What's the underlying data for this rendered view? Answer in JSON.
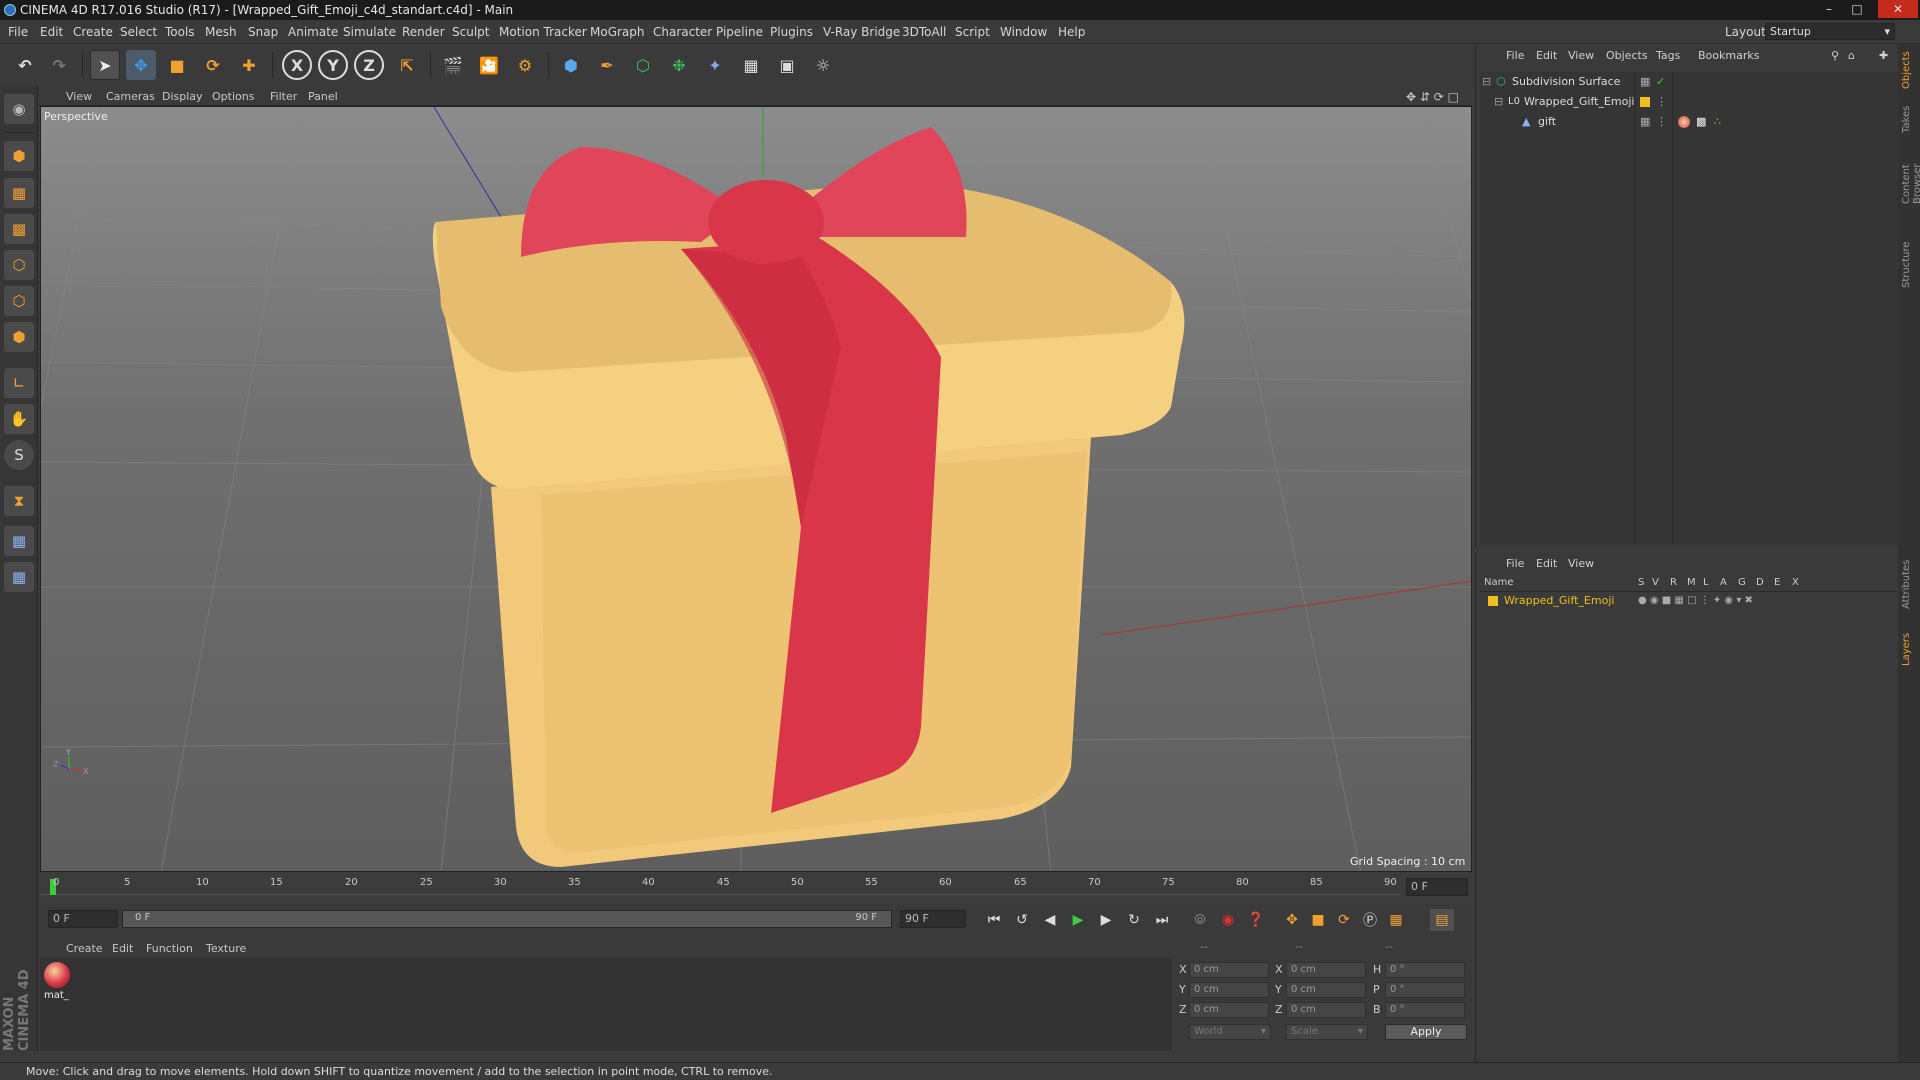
{
  "window": {
    "title": "CINEMA 4D R17.016 Studio (R17) - [Wrapped_Gift_Emoji_c4d_standart.c4d] - Main",
    "controls": [
      "minimize",
      "maximize",
      "close"
    ]
  },
  "menubar": {
    "items": [
      "File",
      "Edit",
      "Create",
      "Select",
      "Tools",
      "Mesh",
      "Snap",
      "Animate",
      "Simulate",
      "Render",
      "Sculpt",
      "Motion Tracker",
      "MoGraph",
      "Character",
      "Pipeline",
      "Plugins",
      "V-Ray Bridge",
      "3DToAll",
      "Script",
      "Window",
      "Help"
    ],
    "layout_label": "Layout:",
    "layout_value": "Startup"
  },
  "toolbar": {
    "axis_x": "X",
    "axis_y": "Y",
    "axis_z": "Z"
  },
  "viewport": {
    "menu": [
      "View",
      "Cameras",
      "Display",
      "Options",
      "Filter",
      "Panel"
    ],
    "camera_label": "Perspective",
    "grid_spacing": "Grid Spacing : 10 cm",
    "gizmo_axes": [
      "Y",
      "Z",
      "X"
    ]
  },
  "timeline": {
    "ticks": [
      "0",
      "5",
      "10",
      "15",
      "20",
      "25",
      "30",
      "35",
      "40",
      "45",
      "50",
      "55",
      "60",
      "65",
      "70",
      "75",
      "80",
      "85",
      "90"
    ],
    "current_frame": "0 F",
    "start_field": "0 F",
    "range_start": "0 F",
    "range_end": "90 F",
    "end_field": "90 F"
  },
  "material_manager": {
    "menu": [
      "Create",
      "Edit",
      "Function",
      "Texture"
    ],
    "materials": [
      {
        "name": "mat_"
      }
    ]
  },
  "coordinates": {
    "header": [
      "--",
      "--",
      "--"
    ],
    "rows": [
      {
        "axis": "X",
        "pos": "0 cm",
        "axis2": "X",
        "size": "0 cm",
        "rot_label": "H",
        "rot": "0 °"
      },
      {
        "axis": "Y",
        "pos": "0 cm",
        "axis2": "Y",
        "size": "0 cm",
        "rot_label": "P",
        "rot": "0 °"
      },
      {
        "axis": "Z",
        "pos": "0 cm",
        "axis2": "Z",
        "size": "0 cm",
        "rot_label": "B",
        "rot": "0 °"
      }
    ],
    "mode_select": "World",
    "type_select": "Scale",
    "apply_label": "Apply"
  },
  "object_manager": {
    "menu": [
      "File",
      "Edit",
      "View",
      "Objects",
      "Tags",
      "Bookmarks"
    ],
    "objects": [
      {
        "name": "Subdivision Surface",
        "level": 0
      },
      {
        "name": "Wrapped_Gift_Emoji",
        "level": 1
      },
      {
        "name": "gift",
        "level": 2
      }
    ]
  },
  "layer_manager": {
    "menu": [
      "File",
      "Edit",
      "View"
    ],
    "columns": [
      "Name",
      "S",
      "V",
      "R",
      "M",
      "L",
      "A",
      "G",
      "D",
      "E",
      "X"
    ],
    "layers": [
      {
        "name": "Wrapped_Gift_Emoji"
      }
    ]
  },
  "right_tabs": [
    "Objects",
    "Takes",
    "Content Browser",
    "Structure",
    "Attributes",
    "Layers"
  ],
  "branding": "MAXON CINEMA 4D",
  "status_text": "Move: Click and drag to move elements. Hold down SHIFT to quantize movement / add to the selection in point mode, CTRL to remove.",
  "colors": {
    "accent_orange": "#f0a030",
    "layer_name": "#f0c020",
    "gift_box": "#f2c87a",
    "ribbon": "#d9364a"
  }
}
